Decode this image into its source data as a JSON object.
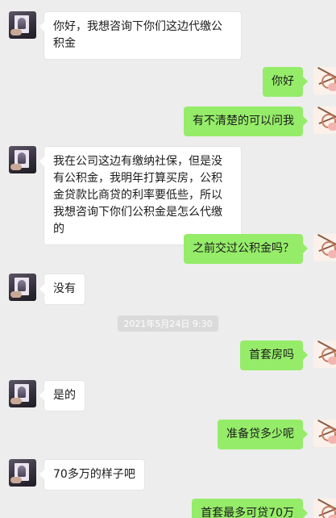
{
  "messages": [
    {
      "side": "left",
      "text": "你好，我想咨询下你们这边代缴公积金"
    },
    {
      "side": "right",
      "text": "你好"
    },
    {
      "side": "right",
      "text": "有不清楚的可以问我"
    },
    {
      "side": "left",
      "text": "我在公司这边有缴纳社保，但是没有公积金，我明年打算买房，公积金贷款比商贷的利率要低些，所以我想咨询下你们公积金是怎么代缴的"
    },
    {
      "side": "right",
      "text": "之前交过公积金吗？"
    },
    {
      "side": "left",
      "text": "没有"
    },
    {
      "side": "timestamp",
      "text": "2021年5月24日 9:30"
    },
    {
      "side": "right",
      "text": "首套房吗"
    },
    {
      "side": "left",
      "text": "是的"
    },
    {
      "side": "right",
      "text": "准备贷多少呢"
    },
    {
      "side": "left",
      "text": "70多万的样子吧"
    },
    {
      "side": "right",
      "text": "首套最多可贷70万"
    }
  ],
  "colors": {
    "background": "#ededed",
    "outgoing_bubble": "#95ec69",
    "incoming_bubble": "#ffffff",
    "timestamp_bg": "#dadada"
  },
  "icons": {
    "left_avatar": "contact-avatar-icon",
    "right_avatar": "self-avatar-icon"
  }
}
